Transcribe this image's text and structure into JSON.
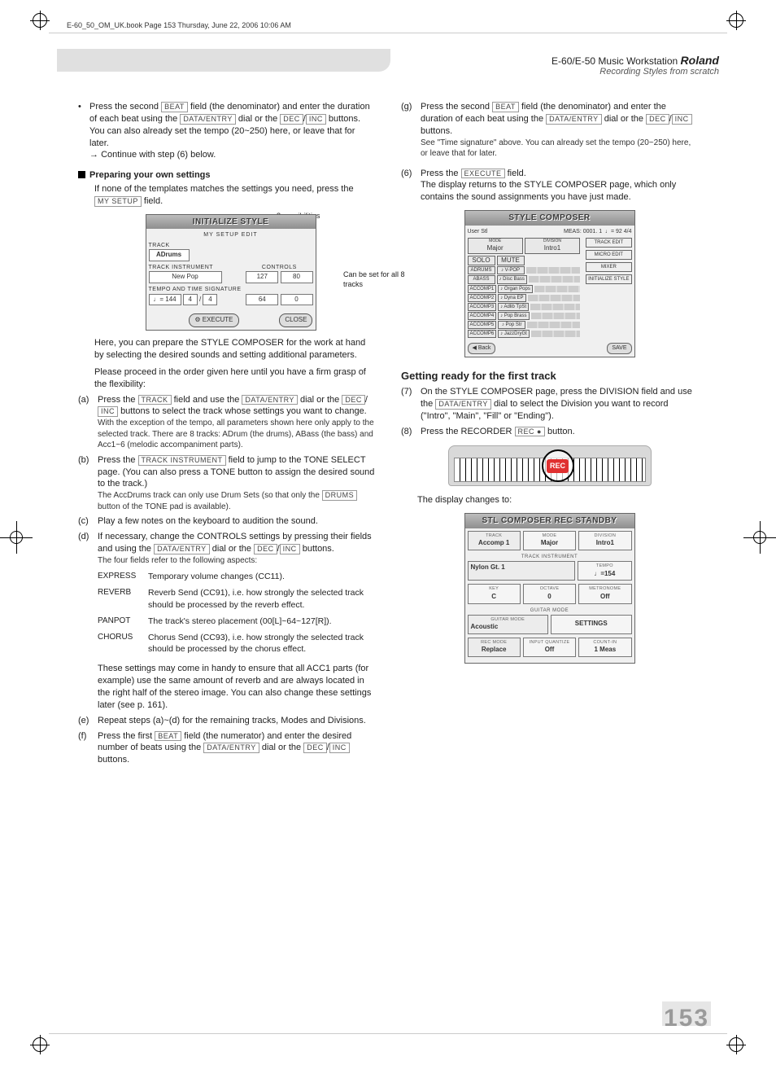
{
  "meta": {
    "file_header": "E-60_50_OM_UK.book  Page 153  Thursday, June 22, 2006  10:06 AM",
    "page_number": "153"
  },
  "header": {
    "product": "E-60/E-50 Music Workstation",
    "brand": "Roland",
    "subtitle": "Recording Styles from scratch"
  },
  "buttons": {
    "beat": "BEAT",
    "data_entry": "DATA/ENTRY",
    "dec": "DEC",
    "inc": "INC",
    "my_setup": "MY SETUP",
    "track": "TRACK",
    "track_instrument": "TRACK INSTRUMENT",
    "drums": "DRUMS",
    "execute": "EXECUTE",
    "rec": "REC ●"
  },
  "left": {
    "bullet1_a": "Press the second ",
    "bullet1_b": " field (the denominator) and enter the duration of each beat using the ",
    "bullet1_c": " dial or the ",
    "bullet1_slash": "/",
    "bullet1_d": " buttons.",
    "bullet1_e": "You can also already set the tempo (20~250) here, or leave that for later.",
    "bullet1_cont": "Continue with step (6) below.",
    "prep_heading": "Preparing your own settings",
    "prep_text_a": "If none of the templates matches the settings you need, press the ",
    "prep_text_b": " field.",
    "fig1_top_callout": "8 possibilities",
    "fig1_right_callout": "Can be set for all 8 tracks",
    "para1": "Here, you can prepare the STYLE COMPOSER for the work at hand by selecting the desired sounds and setting additional parameters.",
    "para2": "Please proceed in the order given here until you have a firm grasp of the flexibility:",
    "a_num": "(a)",
    "a_1": "Press the ",
    "a_2": " field and use the ",
    "a_3": " dial or the ",
    "a_4": " buttons to select the track whose settings you want to change.",
    "a_note": "With the exception of the tempo, all parameters shown here only apply to the selected track. There are 8 tracks: ADrum (the drums), ABass (the bass) and Acc1~6 (melodic accompaniment parts).",
    "b_num": "(b)",
    "b_1": "Press the ",
    "b_2": " field to jump to the TONE SELECT page. (You can also press a TONE button to assign the desired sound to the track.)",
    "b_note": "The AccDrums track can only use Drum Sets (so that only the ",
    "b_note2": " button of the TONE pad is available).",
    "c_num": "(c)",
    "c_text": "Play a few notes on the keyboard to audition the sound.",
    "d_num": "(d)",
    "d_1": "If necessary, change the CONTROLS settings by pressing their fields and using the ",
    "d_2": " dial or the ",
    "d_3": " buttons.",
    "d_note": "The four fields refer to the following aspects:",
    "controls": {
      "express": {
        "term": "EXPRESS",
        "text": "Temporary volume changes (CC11)."
      },
      "reverb": {
        "term": "REVERB",
        "text": "Reverb Send (CC91), i.e. how strongly the selected track should be processed by the reverb effect."
      },
      "panpot": {
        "term": "PANPOT",
        "text": "The track's stereo placement (00[L]~64~127[R])."
      },
      "chorus": {
        "term": "CHORUS",
        "text": "Chorus Send (CC93), i.e. how strongly the selected track should be processed by the chorus effect."
      }
    },
    "d_after": "These settings may come in handy to ensure that all ACC1 parts (for example) use the same amount of reverb and are always located in the right half of the stereo image. You can also change these settings later (see p. 161).",
    "e_num": "(e)",
    "e_text": "Repeat steps (a)~(d) for the remaining tracks, Modes and Divisions.",
    "f_num": "(f)",
    "f_1": "Press the first ",
    "f_2": " field (the numerator) and enter the desired number of beats using the ",
    "f_3": " dial or the ",
    "f_4": " buttons."
  },
  "right": {
    "g_num": "(g)",
    "g_1": "Press the second ",
    "g_2": " field (the denominator) and enter the duration of each beat using the ",
    "g_3": " dial or the ",
    "g_4": " buttons.",
    "g_note": "See \"Time signature\" above. You can already set the tempo (20~250) here, or leave that for later.",
    "s6_num": "(6)",
    "s6_1": "Press the ",
    "s6_2": " field.",
    "s6_text": "The display returns to the STYLE COMPOSER page, which only contains the sound assignments you have just made.",
    "getting_ready": "Getting ready for the first track",
    "s7_num": "(7)",
    "s7_1": "On the STYLE COMPOSER page, press the DIVISION field and use the ",
    "s7_2": " dial to select the Division you want to record (\"Intro\", \"Main\", \"Fill\" or \"Ending\").",
    "s8_num": "(8)",
    "s8_1": "Press the RECORDER ",
    "s8_2": " button.",
    "display_changes": "The display changes to:"
  },
  "fig_init": {
    "title": "INITIALIZE STYLE",
    "subtitle": "MY SETUP EDIT",
    "sect_track": "TRACK",
    "track_val": "ADrums",
    "sect_ti": "TRACK INSTRUMENT",
    "ti_val": "New Pop",
    "sect_controls": "CONTROLS",
    "c1": "127",
    "c2": "80",
    "sect_tempo": "TEMPO AND TIME SIGNATURE",
    "tempo": "♩= 144",
    "ts1": "4",
    "ts_slash": "/",
    "ts2": "4",
    "c3": "64",
    "c4": "0",
    "exec": "EXECUTE",
    "close": "CLOSE"
  },
  "fig_sc": {
    "title": "STYLE COMPOSER",
    "user": "User Stl",
    "meas": "MEAS: 0001. 1",
    "tempo": "♩= 92  4/4",
    "mode": "MODE",
    "mode_v": "Major",
    "div": "DIVISION",
    "div_v": "Intro1",
    "solo": "SOLO",
    "mute": "MUTE",
    "rows": [
      {
        "l": "ADRUMS",
        "r": "♪ V-POP"
      },
      {
        "l": "ABASS",
        "r": "♪ Disc Bass"
      },
      {
        "l": "ACCOMP1",
        "r": "♪ Organ Pops"
      },
      {
        "l": "ACCOMP2",
        "r": "♪ Dyna EP"
      },
      {
        "l": "ACCOMP3",
        "r": "♪ Adlib TpSt"
      },
      {
        "l": "ACCOMP4",
        "r": "♪ Pop Brass"
      },
      {
        "l": "ACCOMP5",
        "r": "♪ Pop Str"
      },
      {
        "l": "ACCOMP6",
        "r": "♪ JazzDryGt"
      }
    ],
    "side": [
      "TRACK EDIT",
      "MICRO EDIT",
      "MIXER",
      "INITIALIZE STYLE"
    ],
    "back": "Back",
    "save": "SAVE"
  },
  "fig_rec": {
    "rec": "REC"
  },
  "fig_standby": {
    "title": "STL COMPOSER REC STANDBY",
    "track_l": "TRACK",
    "track_v": "Accomp 1",
    "mode_l": "MODE",
    "mode_v": "Major",
    "div_l": "DIVISION",
    "div_v": "Intro1",
    "ti_sect": "TRACK INSTRUMENT",
    "ti_v": "Nylon Gt. 1",
    "tempo_l": "TEMPO",
    "tempo_v": "♩=154",
    "key_l": "KEY",
    "key_v": "C",
    "oct_l": "OCTAVE",
    "oct_v": "0",
    "metro_l": "METRONOME",
    "metro_v": "Off",
    "gm_sect": "GUITAR MODE",
    "gm_l": "GUITAR MODE",
    "gm_v": "Acoustic",
    "gm_btn": "SETTINGS",
    "rec_l": "REC MODE",
    "rec_v": "Replace",
    "inp_l": "INPUT QUANTIZE",
    "inp_v": "Off",
    "cnt_l": "COUNT-IN",
    "cnt_v": "1 Meas"
  }
}
